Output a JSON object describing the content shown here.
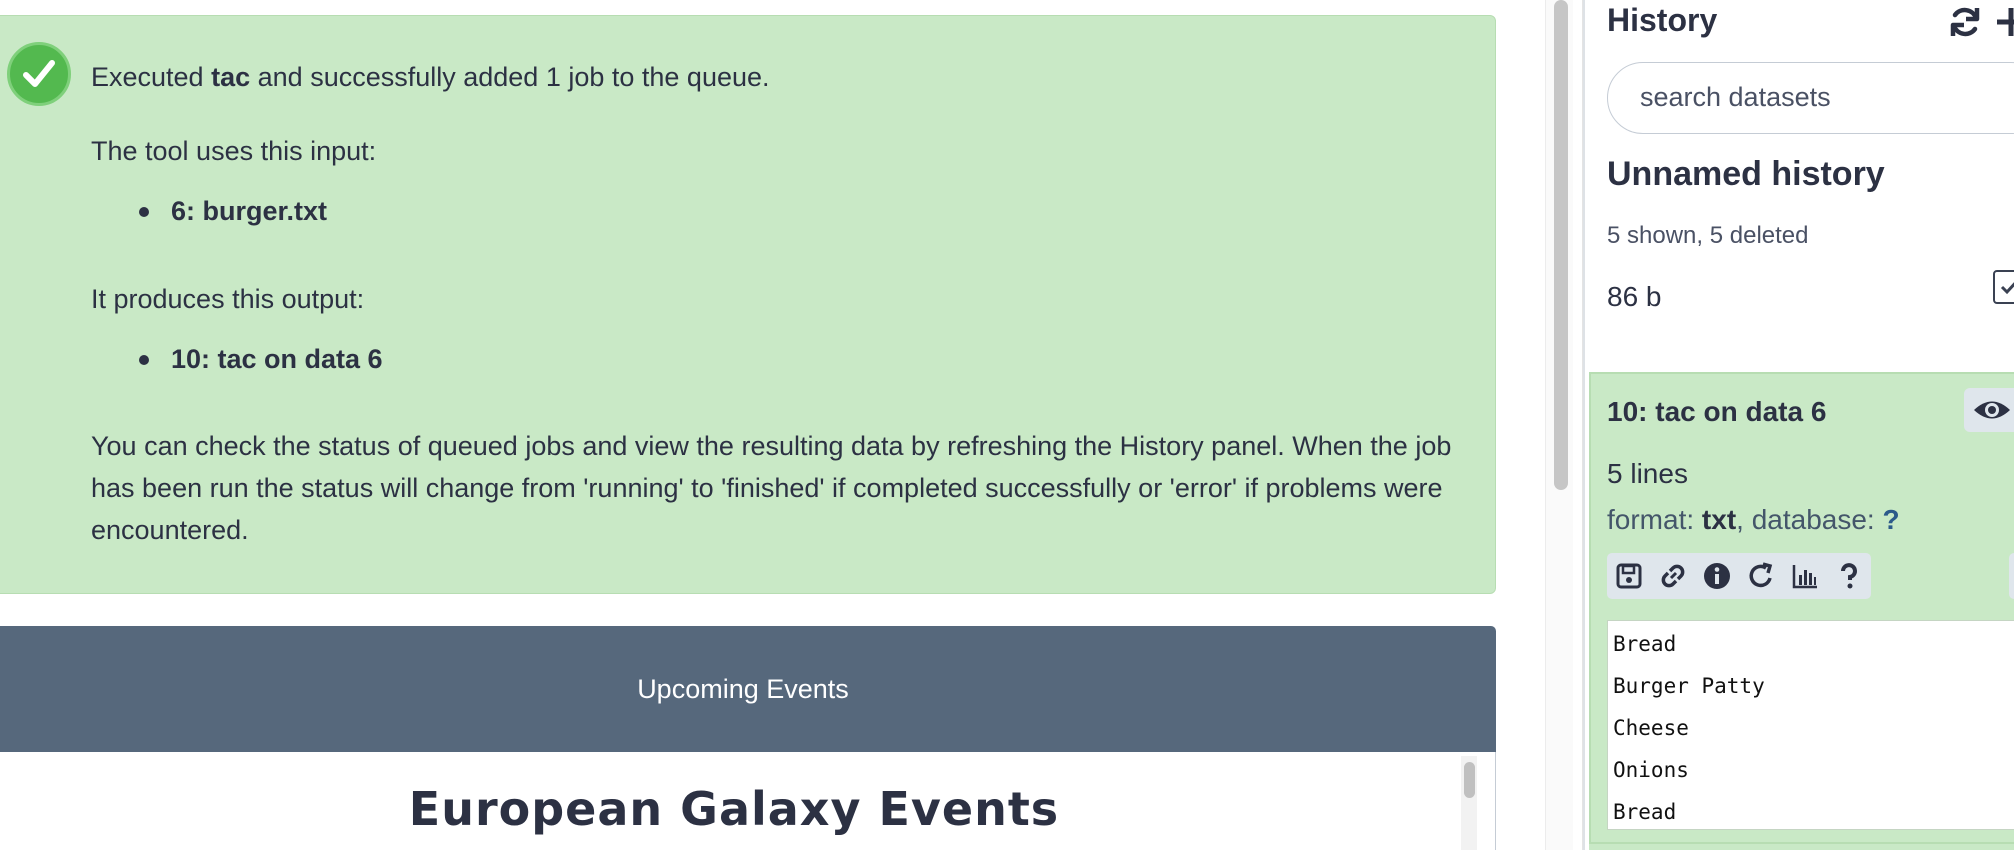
{
  "message": {
    "executed_prefix": "Executed",
    "tool_name": "tac",
    "executed_suffix": "and successfully added 1 job to the queue.",
    "inputs_intro": "The tool uses this input:",
    "inputs": [
      "6: burger.txt"
    ],
    "outputs_intro": "It produces this output:",
    "outputs": [
      "10: tac on data 6"
    ],
    "explanation": "You can check the status of queued jobs and view the resulting data by refreshing the History panel. When the job has been run the status will change from 'running' to 'finished' if completed successfully or 'error' if problems were encountered."
  },
  "events": {
    "header": "Upcoming Events",
    "title": "European Galaxy Events"
  },
  "history": {
    "panel_title": "History",
    "search_placeholder": "search datasets",
    "name": "Unnamed history",
    "counts": "5 shown, 5 deleted",
    "size": "86 b",
    "dataset": {
      "title": "10: tac on data 6",
      "lines": "5 lines",
      "format_label": "format:",
      "format_value": "txt",
      "database_label": ", database:",
      "database_value": "?",
      "peek": [
        "Bread",
        "Burger Patty",
        "Cheese",
        "Onions",
        "Bread"
      ]
    }
  },
  "colors": {
    "success_bg": "#c9e9c6",
    "success_icon": "#53b94f",
    "events_header_bg": "#56687c",
    "text": "#2c3143"
  },
  "icons": {
    "success": "check-circle-icon",
    "refresh": "sync-icon",
    "new_history": "plus-icon",
    "select": "checkbox-icon",
    "view": "eye-icon",
    "toolbar": [
      "save-icon",
      "link-icon",
      "info-icon",
      "rerun-icon",
      "chart-icon",
      "question-icon"
    ]
  }
}
